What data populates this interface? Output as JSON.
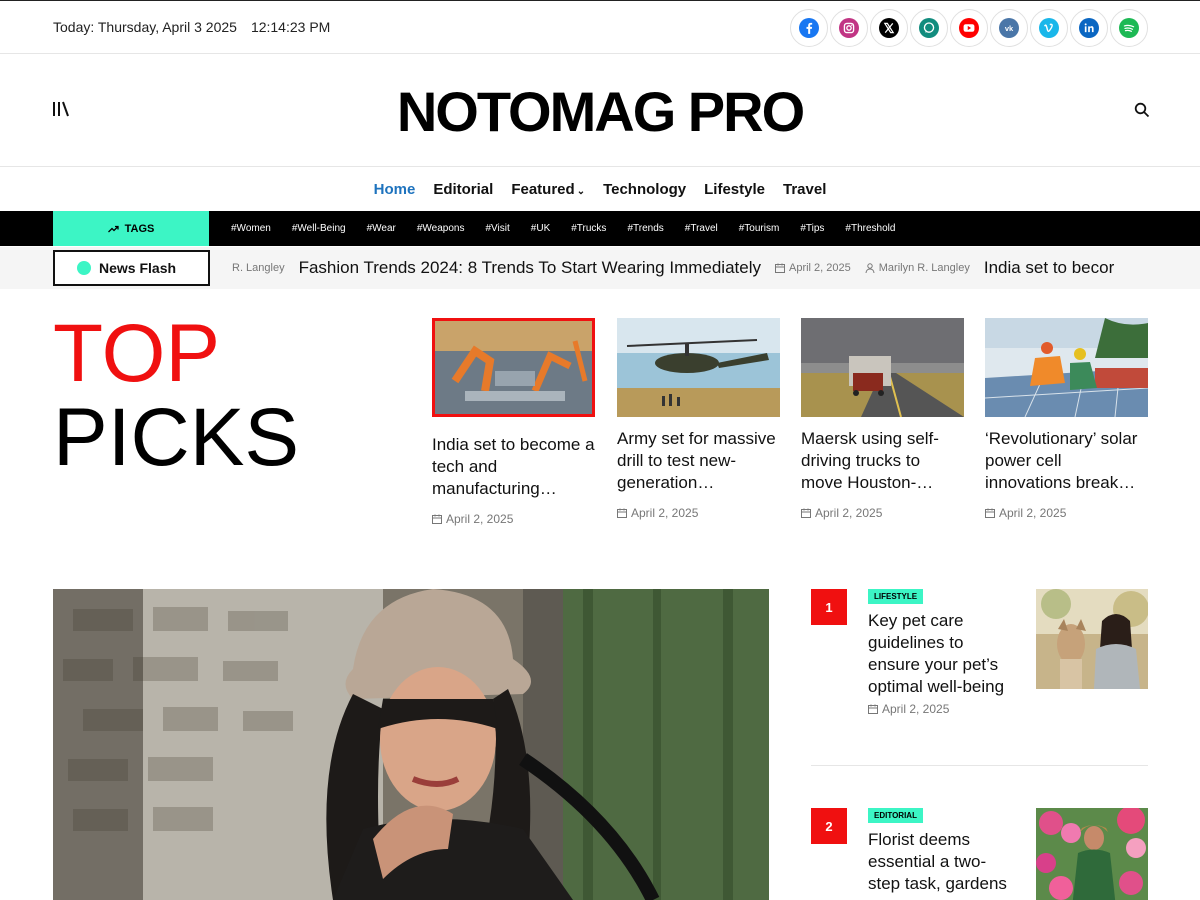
{
  "topbar": {
    "date": "Today: Thursday, April 3 2025",
    "time": "12:14:23 PM",
    "socials": [
      {
        "name": "facebook-icon",
        "color": "#1877f2"
      },
      {
        "name": "instagram-icon",
        "color": "#c13584"
      },
      {
        "name": "x-icon",
        "color": "#000000"
      },
      {
        "name": "whatsapp-icon",
        "color": "#128c7e"
      },
      {
        "name": "youtube-icon",
        "color": "#ff0000"
      },
      {
        "name": "vk-icon",
        "color": "#4a76a8"
      },
      {
        "name": "vimeo-icon",
        "color": "#1ab7ea"
      },
      {
        "name": "linkedin-icon",
        "color": "#0a66c2"
      },
      {
        "name": "spotify-icon",
        "color": "#1db954"
      }
    ]
  },
  "header": {
    "logo": "NOTOMAG PRO"
  },
  "nav": {
    "items": [
      "Home",
      "Editorial",
      "Featured",
      "Technology",
      "Lifestyle",
      "Travel"
    ],
    "active": "Home"
  },
  "tags": {
    "label": "TAGS",
    "items": [
      "#Women",
      "#Well-Being",
      "#Wear",
      "#Weapons",
      "#Visit",
      "#UK",
      "#Trucks",
      "#Trends",
      "#Travel",
      "#Tourism",
      "#Tips",
      "#Threshold"
    ]
  },
  "newsflash": {
    "label": "News Flash",
    "items": [
      {
        "author": "R. Langley",
        "title": "Fashion Trends 2024: 8 Trends To Start Wearing Immediately",
        "date": "April 2, 2025"
      },
      {
        "author": "Marilyn R. Langley",
        "title": "India set to becor"
      }
    ]
  },
  "top_picks": {
    "title_line1": "TOP",
    "title_line2": "PICKS",
    "items": [
      {
        "title": "India set to become a tech and manufacturing…",
        "date": "April 2, 2025"
      },
      {
        "title": "Army set for massive drill to test new-generation…",
        "date": "April 2, 2025"
      },
      {
        "title": "Maersk using self-driving trucks to move Houston-…",
        "date": "April 2, 2025"
      },
      {
        "title": "‘Revolutionary’ solar power cell innovations break…",
        "date": "April 2, 2025"
      }
    ]
  },
  "side_list": [
    {
      "num": "1",
      "category": "LIFESTYLE",
      "title": "Key pet care guidelines to ensure your pet’s optimal well-being",
      "date": "April 2, 2025"
    },
    {
      "num": "2",
      "category": "EDITORIAL",
      "title": "Florist deems essential a two-step task, gardens",
      "date": ""
    }
  ],
  "colors": {
    "accent": "#3cf5c5",
    "red": "#f01010",
    "nav_active": "#1e73be"
  }
}
